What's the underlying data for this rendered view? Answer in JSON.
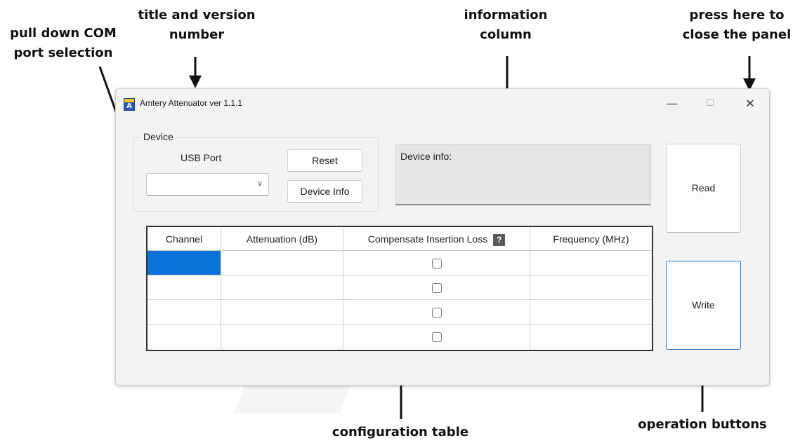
{
  "annotations": {
    "com_port": "pull down COM\nport selection",
    "title_version": "title and version\nnumber",
    "info_column": "information\ncolumn",
    "close_panel": "press here to\nclose the panel",
    "config_table": "configuration table",
    "operation_buttons": "operation buttons"
  },
  "window": {
    "title": "Amtery Attenuator ver 1.1.1",
    "icon_letter": "A",
    "minimize_symbol": "—",
    "maximize_symbol": "☐",
    "close_symbol": "✕"
  },
  "device": {
    "group_label": "Device",
    "usb_port_label": "USB Port",
    "usb_port_value": "",
    "reset_label": "Reset",
    "device_info_label": "Device Info"
  },
  "info": {
    "label": "Device info:"
  },
  "actions": {
    "read_label": "Read",
    "write_label": "Write"
  },
  "table": {
    "headers": [
      "Channel",
      "Attenuation (dB)",
      "Compensate Insertion Loss",
      "Frequency (MHz)"
    ],
    "help_symbol": "?",
    "rows": [
      {
        "channel": "",
        "attenuation": "",
        "compensate": false,
        "frequency": "",
        "selected": true
      },
      {
        "channel": "",
        "attenuation": "",
        "compensate": false,
        "frequency": ""
      },
      {
        "channel": "",
        "attenuation": "",
        "compensate": false,
        "frequency": ""
      },
      {
        "channel": "",
        "attenuation": "",
        "compensate": false,
        "frequency": ""
      }
    ]
  },
  "colors": {
    "selection": "#0a74da",
    "write_border": "#1f7fd6",
    "window_bg": "#f3f3f3"
  }
}
